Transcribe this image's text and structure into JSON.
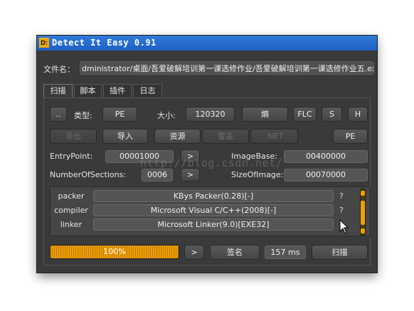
{
  "window": {
    "title": "Detect It Easy 0.91",
    "icon_text": "D:"
  },
  "file": {
    "label": "文件名：",
    "path": "dministrator/桌面/吾爱破解培训第一课选修作业/吾爱破解培训第一课选修作业五.exe"
  },
  "tabs": [
    {
      "label": "扫描",
      "active": true
    },
    {
      "label": "脚本"
    },
    {
      "label": "插件"
    },
    {
      "label": "日志"
    }
  ],
  "row1": {
    "browse_label": "..",
    "type_label": "类型:",
    "type_value": "PE",
    "size_label": "大小:",
    "size_value": "120320",
    "entropy_label": "熵",
    "flc_label": "FLC",
    "s_label": "S",
    "h_label": "H"
  },
  "row2": {
    "export_label": "导出",
    "import_label": "导入",
    "resource_label": "资源",
    "overlay_label": "覆盖",
    "net_label": ".NET",
    "pe_label": "PE"
  },
  "pe_info": {
    "entry_label": "EntryPoint:",
    "entry_value": "00001000",
    "entry_btn": ">",
    "imagebase_label": "ImageBase:",
    "imagebase_value": "00400000",
    "sections_label": "NumberOfSections:",
    "sections_value": "0006",
    "sections_btn": ">",
    "sizeofimage_label": "SizeOfImage:",
    "sizeofimage_value": "00070000"
  },
  "results": [
    {
      "type": "packer",
      "value": "KBys Packer(0.28)[-]",
      "q": "?"
    },
    {
      "type": "compiler",
      "value": "Microsoft Visual C/C++(2008)[-]",
      "q": "?"
    },
    {
      "type": "linker",
      "value": "Microsoft Linker(9.0)[EXE32]",
      "q": ""
    }
  ],
  "bottom": {
    "progress_text": "100%",
    "progress_value": 1.0,
    "next_label": ">",
    "signature_label": "签名",
    "time_value": "157 ms",
    "scan_label": "扫描"
  },
  "watermark": "http://blog.csdn.net/",
  "colors": {
    "accent": "#f0a000",
    "titlebar": "#2f7bd8",
    "background": "#3a3a3a"
  }
}
